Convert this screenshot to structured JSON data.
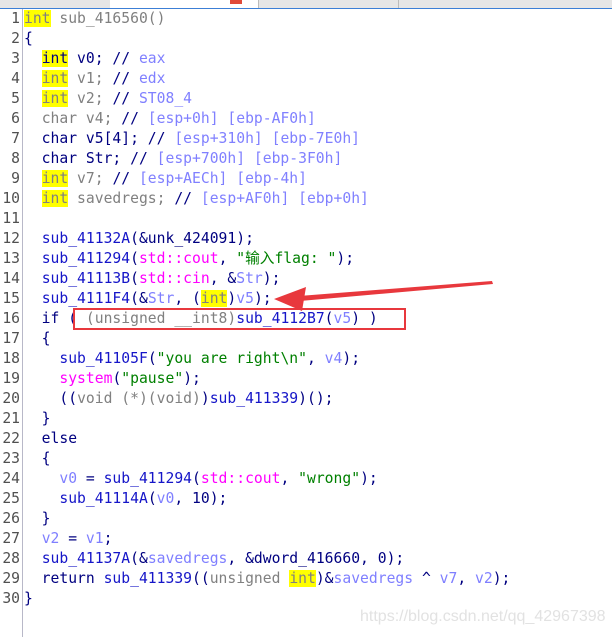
{
  "function_name": "sub_416560",
  "colors": {
    "keyword": "#000080",
    "function": "#1515c8",
    "variable": "#7f7fff",
    "comment": "#8080ff",
    "type_gray": "#808080",
    "string": "#008000",
    "library": "#ff00ff",
    "highlight": "#ffff00",
    "annotation": "#e8383d"
  },
  "annotation": {
    "box_target_line": 16,
    "arrow_target_line": 15
  },
  "watermark": "https://blog.csdn.net/qq_42967398",
  "lines": [
    {
      "n": "1",
      "tokens": [
        [
          "g h",
          "int"
        ],
        [
          "g",
          " sub_416560()"
        ]
      ]
    },
    {
      "n": "2",
      "tokens": [
        [
          "p",
          "{"
        ]
      ]
    },
    {
      "n": "3",
      "tokens": [
        [
          "p",
          "  "
        ],
        [
          "p h",
          "int"
        ],
        [
          "p",
          " v0; //"
        ],
        [
          "c",
          " eax"
        ]
      ]
    },
    {
      "n": "4",
      "tokens": [
        [
          "p",
          "  "
        ],
        [
          "g h",
          "int"
        ],
        [
          "g",
          " v1; "
        ],
        [
          "p",
          "//"
        ],
        [
          "c",
          " edx"
        ]
      ]
    },
    {
      "n": "5",
      "tokens": [
        [
          "p",
          "  "
        ],
        [
          "g h",
          "int"
        ],
        [
          "g",
          " v2; "
        ],
        [
          "p",
          "//"
        ],
        [
          "c",
          " ST08_4"
        ]
      ]
    },
    {
      "n": "6",
      "tokens": [
        [
          "p",
          "  "
        ],
        [
          "g",
          "char v4; "
        ],
        [
          "p",
          "//"
        ],
        [
          "c",
          " [esp+0h] [ebp-AF0h]"
        ]
      ]
    },
    {
      "n": "7",
      "tokens": [
        [
          "p",
          "  char v5[4]; //"
        ],
        [
          "c",
          " [esp+310h] [ebp-7E0h]"
        ]
      ]
    },
    {
      "n": "8",
      "tokens": [
        [
          "p",
          "  char Str; //"
        ],
        [
          "c",
          " [esp+700h] [ebp-3F0h]"
        ]
      ]
    },
    {
      "n": "9",
      "tokens": [
        [
          "p",
          "  "
        ],
        [
          "g h",
          "int"
        ],
        [
          "g",
          " v7; "
        ],
        [
          "p",
          "//"
        ],
        [
          "c",
          " [esp+AECh] [ebp-4h]"
        ]
      ]
    },
    {
      "n": "10",
      "tokens": [
        [
          "p",
          "  "
        ],
        [
          "g h",
          "int"
        ],
        [
          "g",
          " savedregs; "
        ],
        [
          "p",
          "//"
        ],
        [
          "c",
          " [esp+AF0h] [ebp+0h]"
        ]
      ]
    },
    {
      "n": "11",
      "tokens": []
    },
    {
      "n": "12",
      "tokens": [
        [
          "p",
          "  "
        ],
        [
          "f",
          "sub_41132A"
        ],
        [
          "p",
          "(&unk_424091);"
        ]
      ]
    },
    {
      "n": "13",
      "tokens": [
        [
          "p",
          "  "
        ],
        [
          "f",
          "sub_411294"
        ],
        [
          "p",
          "("
        ],
        [
          "m",
          "std::cout"
        ],
        [
          "p",
          ", "
        ],
        [
          "s",
          "\"输入flag: \""
        ],
        [
          "p",
          ");"
        ]
      ]
    },
    {
      "n": "14",
      "tokens": [
        [
          "p",
          "  "
        ],
        [
          "f",
          "sub_41113B"
        ],
        [
          "p",
          "("
        ],
        [
          "m",
          "std::cin"
        ],
        [
          "p",
          ", &"
        ],
        [
          "v",
          "Str"
        ],
        [
          "p",
          ");"
        ]
      ]
    },
    {
      "n": "15",
      "tokens": [
        [
          "p",
          "  "
        ],
        [
          "f",
          "sub_4111F4"
        ],
        [
          "p",
          "(&"
        ],
        [
          "v",
          "Str"
        ],
        [
          "p",
          ", ("
        ],
        [
          "g h",
          "int"
        ],
        [
          "p",
          ")"
        ],
        [
          "v",
          "v5"
        ],
        [
          "p",
          ");"
        ]
      ]
    },
    {
      "n": "16",
      "tokens": [
        [
          "p",
          "  if ( "
        ],
        [
          "g",
          "(unsigned __int8)"
        ],
        [
          "f",
          "sub_4112B7"
        ],
        [
          "p",
          "("
        ],
        [
          "v",
          "v5"
        ],
        [
          "p",
          ") )"
        ]
      ]
    },
    {
      "n": "17",
      "tokens": [
        [
          "p",
          "  {"
        ]
      ]
    },
    {
      "n": "18",
      "tokens": [
        [
          "p",
          "    "
        ],
        [
          "f",
          "sub_41105F"
        ],
        [
          "p",
          "("
        ],
        [
          "s",
          "\"you are right\\n\""
        ],
        [
          "p",
          ", "
        ],
        [
          "v",
          "v4"
        ],
        [
          "p",
          ");"
        ]
      ]
    },
    {
      "n": "19",
      "tokens": [
        [
          "p",
          "    "
        ],
        [
          "m",
          "system"
        ],
        [
          "p",
          "("
        ],
        [
          "s",
          "\"pause\""
        ],
        [
          "p",
          ");"
        ]
      ]
    },
    {
      "n": "20",
      "tokens": [
        [
          "p",
          "    (("
        ],
        [
          "g",
          "void (*)(void)"
        ],
        [
          "p",
          ")"
        ],
        [
          "f",
          "sub_411339"
        ],
        [
          "p",
          ")();"
        ]
      ]
    },
    {
      "n": "21",
      "tokens": [
        [
          "p",
          "  }"
        ]
      ]
    },
    {
      "n": "22",
      "tokens": [
        [
          "p",
          "  else"
        ]
      ]
    },
    {
      "n": "23",
      "tokens": [
        [
          "p",
          "  {"
        ]
      ]
    },
    {
      "n": "24",
      "tokens": [
        [
          "p",
          "    "
        ],
        [
          "v",
          "v0"
        ],
        [
          "p",
          " = "
        ],
        [
          "f",
          "sub_411294"
        ],
        [
          "p",
          "("
        ],
        [
          "m",
          "std::cout"
        ],
        [
          "p",
          ", "
        ],
        [
          "s",
          "\"wrong\""
        ],
        [
          "p",
          ");"
        ]
      ]
    },
    {
      "n": "25",
      "tokens": [
        [
          "p",
          "    "
        ],
        [
          "f",
          "sub_41114A"
        ],
        [
          "p",
          "("
        ],
        [
          "v",
          "v0"
        ],
        [
          "p",
          ", 10);"
        ]
      ]
    },
    {
      "n": "26",
      "tokens": [
        [
          "p",
          "  }"
        ]
      ]
    },
    {
      "n": "27",
      "tokens": [
        [
          "p",
          "  "
        ],
        [
          "v",
          "v2"
        ],
        [
          "p",
          " = "
        ],
        [
          "v",
          "v1"
        ],
        [
          "p",
          ";"
        ]
      ]
    },
    {
      "n": "28",
      "tokens": [
        [
          "p",
          "  "
        ],
        [
          "f",
          "sub_41137A"
        ],
        [
          "p",
          "(&"
        ],
        [
          "v",
          "savedregs"
        ],
        [
          "p",
          ", &dword_416660, 0);"
        ]
      ]
    },
    {
      "n": "29",
      "tokens": [
        [
          "p",
          "  return "
        ],
        [
          "f",
          "sub_411339"
        ],
        [
          "p",
          "(("
        ],
        [
          "g",
          "unsigned "
        ],
        [
          "g h",
          "int"
        ],
        [
          "p",
          ")&"
        ],
        [
          "v",
          "savedregs"
        ],
        [
          "p",
          " ^ "
        ],
        [
          "v",
          "v7"
        ],
        [
          "p",
          ", "
        ],
        [
          "v",
          "v2"
        ],
        [
          "p",
          ");"
        ]
      ]
    },
    {
      "n": "30",
      "tokens": [
        [
          "p",
          "}"
        ]
      ]
    }
  ]
}
